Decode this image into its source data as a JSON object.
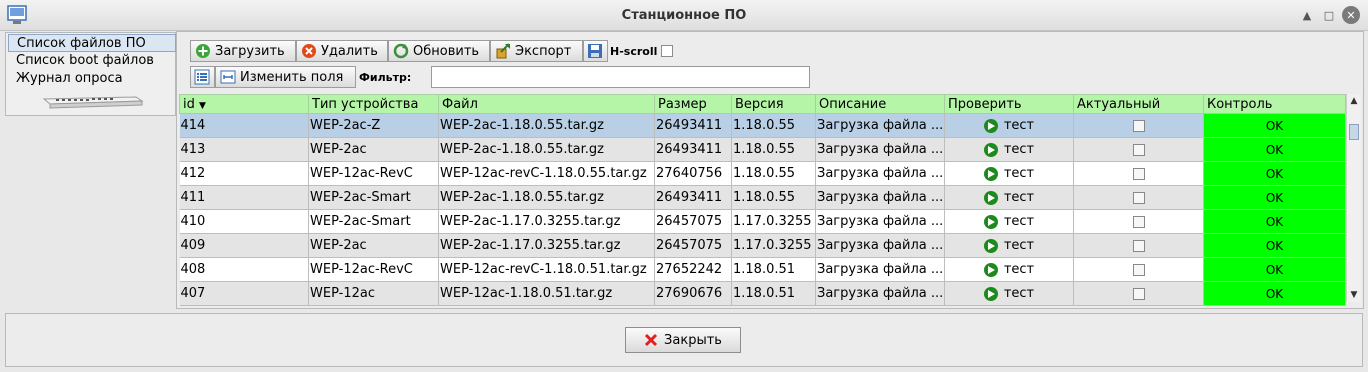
{
  "window": {
    "title": "Станционное ПО"
  },
  "sidebar": {
    "tabs": [
      {
        "label": "Список файлов ПО"
      },
      {
        "label": "Список boot файлов"
      },
      {
        "label": "Журнал опроса"
      }
    ]
  },
  "toolbar": {
    "upload_label": "Загрузить",
    "delete_label": "Удалить",
    "refresh_label": "Обновить",
    "export_label": "Экспорт",
    "hscroll_label": "H-scroll",
    "edit_fields_label": "Изменить поля",
    "filter_label": "Фильтр:",
    "filter_value": ""
  },
  "table": {
    "columns": [
      "id",
      "Тип устройства",
      "Файл",
      "Размер",
      "Версия",
      "Описание",
      "Проверить",
      "Актуальный",
      "Контроль"
    ],
    "sort_column": "id",
    "sort_direction": "descending",
    "rows": [
      {
        "id": "414",
        "type": "WEP-2ac-Z",
        "file": "WEP-2ac-1.18.0.55.tar.gz",
        "size": "26493411",
        "version": "1.18.0.55",
        "description": "Загрузка файла ...",
        "check": "тест",
        "actual": false,
        "control": "OK",
        "selected": true
      },
      {
        "id": "413",
        "type": "WEP-2ac",
        "file": "WEP-2ac-1.18.0.55.tar.gz",
        "size": "26493411",
        "version": "1.18.0.55",
        "description": "Загрузка файла ...",
        "check": "тест",
        "actual": false,
        "control": "OK"
      },
      {
        "id": "412",
        "type": "WEP-12ac-RevC",
        "file": "WEP-12ac-revC-1.18.0.55.tar.gz",
        "size": "27640756",
        "version": "1.18.0.55",
        "description": "Загрузка файла ...",
        "check": "тест",
        "actual": false,
        "control": "OK"
      },
      {
        "id": "411",
        "type": "WEP-2ac-Smart",
        "file": "WEP-2ac-1.18.0.55.tar.gz",
        "size": "26493411",
        "version": "1.18.0.55",
        "description": "Загрузка файла ...",
        "check": "тест",
        "actual": false,
        "control": "OK"
      },
      {
        "id": "410",
        "type": "WEP-2ac-Smart",
        "file": "WEP-2ac-1.17.0.3255.tar.gz",
        "size": "26457075",
        "version": "1.17.0.3255",
        "description": "Загрузка файла ...",
        "check": "тест",
        "actual": false,
        "control": "OK"
      },
      {
        "id": "409",
        "type": "WEP-2ac",
        "file": "WEP-2ac-1.17.0.3255.tar.gz",
        "size": "26457075",
        "version": "1.17.0.3255",
        "description": "Загрузка файла ...",
        "check": "тест",
        "actual": false,
        "control": "OK"
      },
      {
        "id": "408",
        "type": "WEP-12ac-RevC",
        "file": "WEP-12ac-revC-1.18.0.51.tar.gz",
        "size": "27652242",
        "version": "1.18.0.51",
        "description": "Загрузка файла ...",
        "check": "тест",
        "actual": false,
        "control": "OK"
      },
      {
        "id": "407",
        "type": "WEP-12ac",
        "file": "WEP-12ac-1.18.0.51.tar.gz",
        "size": "27690676",
        "version": "1.18.0.51",
        "description": "Загрузка файла ...",
        "check": "тест",
        "actual": false,
        "control": "OK"
      }
    ]
  },
  "footer": {
    "close_label": "Закрыть"
  },
  "colors": {
    "header_green": "#b5f5a7",
    "control_ok": "#00ff00",
    "selected_row": "#b9cfe5",
    "play_icon": "#1c8a1c"
  }
}
